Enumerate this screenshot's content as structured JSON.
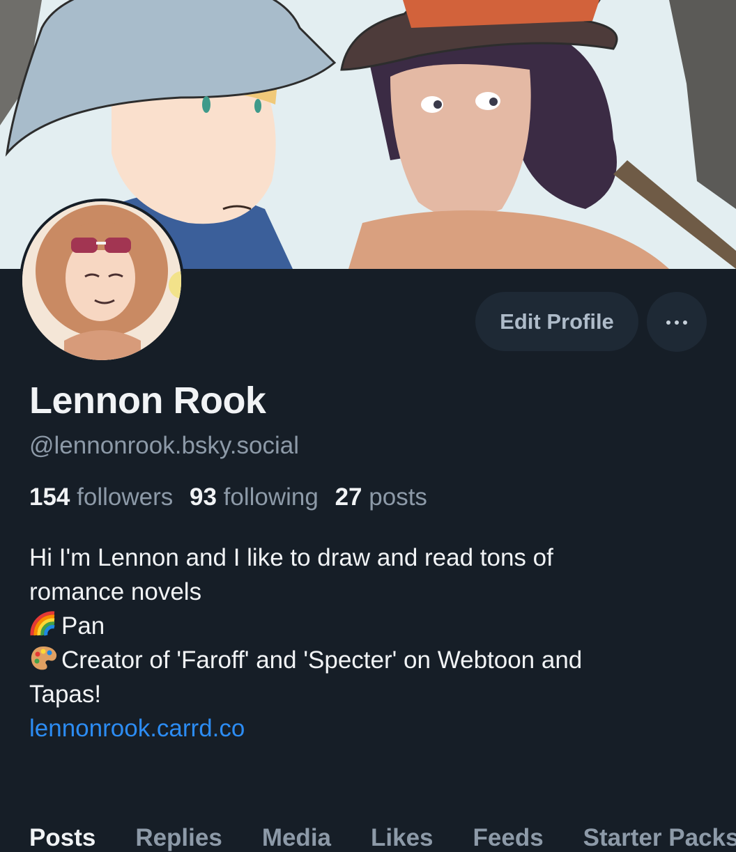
{
  "banner": {
    "image": "comic-art-two-characters"
  },
  "avatar": {
    "image": "profile-avatar-illustration"
  },
  "actions": {
    "edit_profile": "Edit Profile",
    "more": "more-icon"
  },
  "profile": {
    "display_name": "Lennon Rook",
    "handle": "@lennonrook.bsky.social"
  },
  "stats": {
    "followers_count": "154",
    "followers_label": "followers",
    "following_count": "93",
    "following_label": "following",
    "posts_count": "27",
    "posts_label": "posts"
  },
  "bio": {
    "line1": "Hi I'm Lennon and I like to draw and read tons of",
    "line2": "romance novels",
    "line3_icon": "rainbow-emoji",
    "line3": "Pan",
    "line4_icon": "palette-emoji",
    "line4": "Creator of 'Faroff' and 'Specter' on Webtoon and",
    "line5": "Tapas!",
    "link": "lennonrook.carrd.co"
  },
  "tabs": [
    "Posts",
    "Replies",
    "Media",
    "Likes",
    "Feeds",
    "Starter Packs"
  ],
  "colors": {
    "background": "#161e27",
    "button_bg": "#1e2935",
    "muted_text": "#8d9aa8",
    "link": "#2c8cf3"
  }
}
